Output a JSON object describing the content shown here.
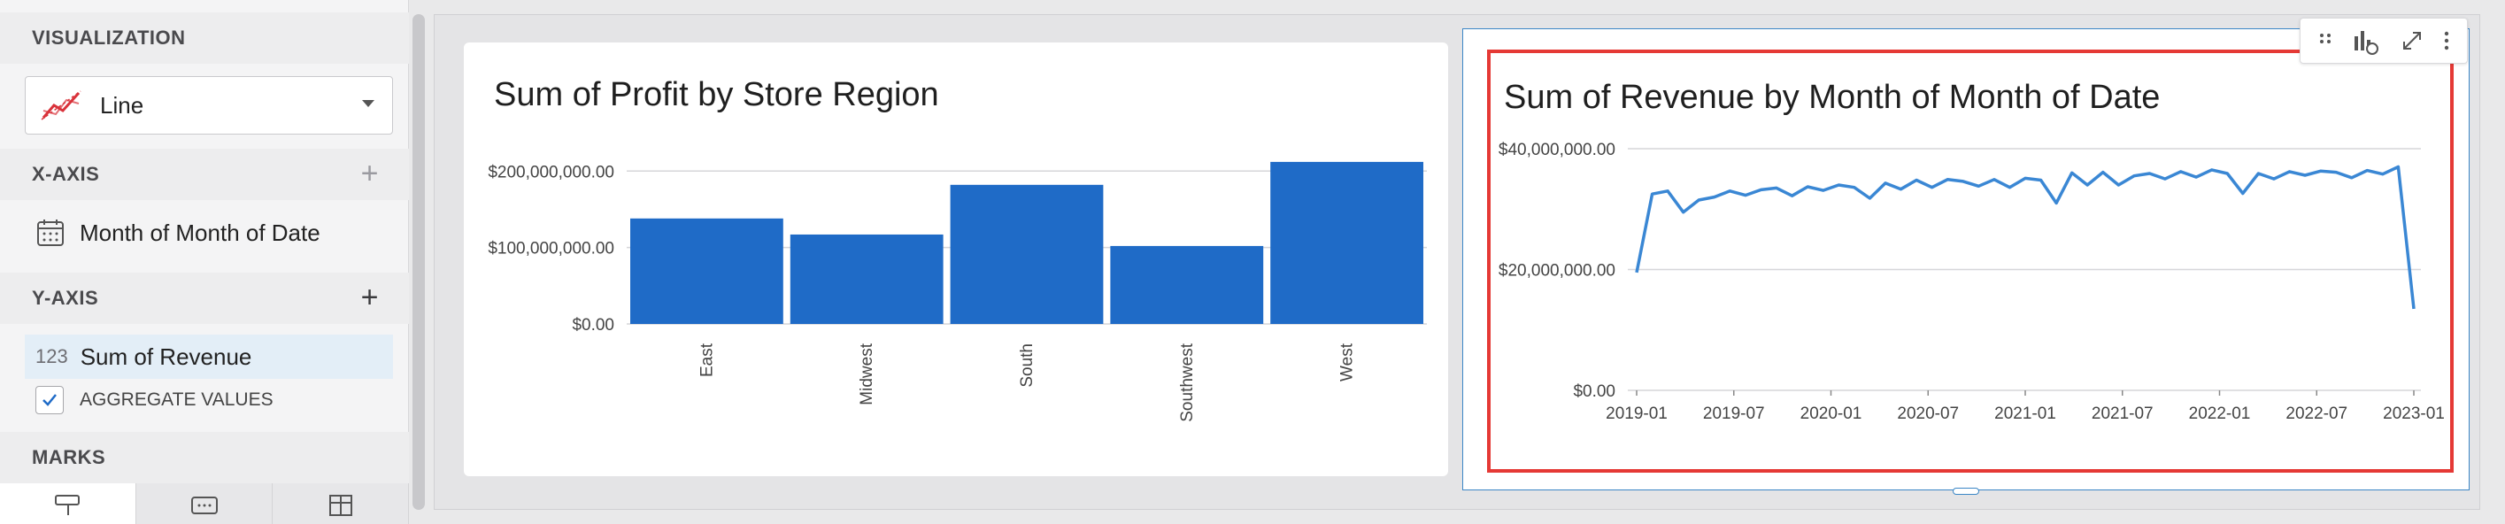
{
  "panel": {
    "visualization_header": "VISUALIZATION",
    "viz_type": "Line",
    "x_axis_header": "X-AXIS",
    "x_field": "Month of Month of Date",
    "y_axis_header": "Y-AXIS",
    "y_field_tag": "123",
    "y_field": "Sum of Revenue",
    "aggregate_label": "AGGREGATE VALUES",
    "marks_header": "MARKS"
  },
  "colors": {
    "bar": "#1f6bc7",
    "line": "#3a87d4",
    "highlight": "#e53935",
    "selection": "#3b86c6"
  },
  "chart_data": [
    {
      "type": "bar",
      "title": "Sum of Profit by Store Region",
      "categories": [
        "East",
        "Midwest",
        "South",
        "Southwest",
        "West"
      ],
      "values": [
        138000000,
        117000000,
        182000000,
        102000000,
        212000000
      ],
      "y_ticks": [
        0,
        100000000,
        200000000
      ],
      "y_tick_labels": [
        "$0.00",
        "$100,000,000.00",
        "$200,000,000.00"
      ],
      "ylim": [
        0,
        220000000
      ],
      "grid": true
    },
    {
      "type": "line",
      "title": "Sum of Revenue by Month of Month of Date",
      "x": [
        "2019-01",
        "2019-02",
        "2019-03",
        "2019-04",
        "2019-05",
        "2019-06",
        "2019-07",
        "2019-08",
        "2019-09",
        "2019-10",
        "2019-11",
        "2019-12",
        "2020-01",
        "2020-02",
        "2020-03",
        "2020-04",
        "2020-05",
        "2020-06",
        "2020-07",
        "2020-08",
        "2020-09",
        "2020-10",
        "2020-11",
        "2020-12",
        "2021-01",
        "2021-02",
        "2021-03",
        "2021-04",
        "2021-05",
        "2021-06",
        "2021-07",
        "2021-08",
        "2021-09",
        "2021-10",
        "2021-11",
        "2021-12",
        "2022-01",
        "2022-02",
        "2022-03",
        "2022-04",
        "2022-05",
        "2022-06",
        "2022-07",
        "2022-08",
        "2022-09",
        "2022-10",
        "2022-11",
        "2022-12",
        "2023-01",
        "2023-02"
      ],
      "values": [
        19500000,
        32500000,
        33000000,
        29500000,
        31500000,
        32000000,
        33000000,
        32300000,
        33200000,
        33500000,
        32200000,
        33700000,
        33100000,
        34000000,
        33600000,
        31800000,
        34300000,
        33300000,
        34800000,
        33600000,
        34900000,
        34600000,
        33800000,
        34900000,
        33600000,
        35100000,
        34800000,
        31000000,
        36000000,
        34000000,
        36100000,
        34000000,
        35500000,
        35900000,
        35000000,
        36200000,
        35300000,
        36500000,
        35900000,
        32600000,
        35900000,
        35000000,
        36200000,
        35600000,
        36300000,
        36100000,
        35200000,
        36400000,
        35800000,
        37000000,
        13500000
      ],
      "x_tick_labels": [
        "2019-01",
        "2019-07",
        "2020-01",
        "2020-07",
        "2021-01",
        "2021-07",
        "2022-01",
        "2022-07",
        "2023-01"
      ],
      "y_ticks": [
        0,
        20000000,
        40000000
      ],
      "y_tick_labels": [
        "$0.00",
        "$20,000,000.00",
        "$40,000,000.00"
      ],
      "ylim": [
        0,
        40000000
      ],
      "grid": true
    }
  ]
}
